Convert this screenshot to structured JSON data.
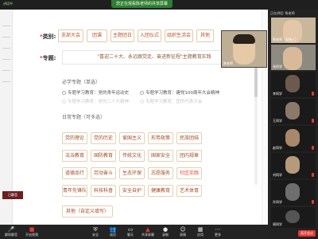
{
  "meeting": {
    "share_banner": "您正在观看陈老师的共享屏幕",
    "panel_title": "正在讲话: 陈老师",
    "speaker_tag": "讲话中"
  },
  "form": {
    "category_label": "类别:",
    "categories": [
      "支部大会",
      "团课",
      "主题团日",
      "入团仪式",
      "组织生活会",
      "其他"
    ],
    "topic_label": "专题:",
    "topic_value": "\"喜迎二十大、永远跟党走、奋进新征程\"主题教育实践",
    "required_title": "必学专题（单选）",
    "required_options": [
      {
        "label": "专题学习教育：党的青年运动史",
        "dim": false
      },
      {
        "label": "专题学习教育：建党100周年大会精神",
        "dim": false
      },
      {
        "label": "专题学习教育：党的二十大精神",
        "dim": true
      },
      {
        "label": "专题学习教育：团的代表大会",
        "dim": true
      }
    ],
    "daily_title": "日常专题（可多选）",
    "daily_rows": [
      [
        "党的理论",
        "党的历史",
        "爱国主义",
        "形势政策",
        "民族团结"
      ],
      [
        "法治教育",
        "国防教育",
        "传统文化",
        "国家安全",
        "团内规章"
      ],
      [
        "道德品行",
        "劳动奋斗",
        "生态环保",
        "志愿服务",
        "社区实践"
      ],
      [
        "青年先锋队",
        "科技科普",
        "安全自护",
        "健康教育",
        "艺术体育"
      ]
    ],
    "daily_other": "其他（自定义填写）"
  },
  "participants": [
    {
      "name": "陈老师（主持人）",
      "video": true
    },
    {
      "name": "张同学",
      "video": true
    },
    {
      "name": "李同学",
      "video": false
    },
    {
      "name": "王同学",
      "video": false
    },
    {
      "name": "赵同学",
      "video": false
    },
    {
      "name": "刘同学",
      "video": false
    },
    {
      "name": "孙同学",
      "video": false
    },
    {
      "name": "周同学",
      "video": false
    }
  ],
  "main_video_name": "陈老师",
  "left_badge": "已静音",
  "toolbar": [
    {
      "icon": "mic-icon",
      "label": "解除静音",
      "red": true
    },
    {
      "icon": "camera-icon",
      "label": "开启视频",
      "red": true
    },
    {
      "icon": "security-icon",
      "label": "安全"
    },
    {
      "icon": "participants-icon",
      "label": "成员"
    },
    {
      "icon": "chat-icon",
      "label": "聊天"
    },
    {
      "icon": "share-icon",
      "label": "共享屏幕"
    },
    {
      "icon": "record-icon",
      "label": "录制"
    },
    {
      "icon": "reaction-icon",
      "label": "表情"
    },
    {
      "icon": "apps-icon",
      "label": "应用"
    },
    {
      "icon": "more-icon",
      "label": "更多"
    }
  ],
  "end_label": "离开会议",
  "colors": {
    "accent": "#b5532b",
    "red": "#e53935",
    "green": "#2e7d32"
  }
}
